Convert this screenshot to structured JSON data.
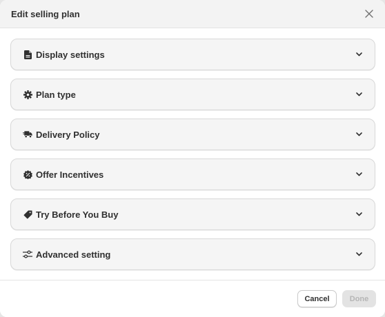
{
  "modal": {
    "title": "Edit selling plan",
    "close_icon": "close-icon"
  },
  "sections": [
    {
      "label": "Display settings",
      "icon": "document-icon"
    },
    {
      "label": "Plan type",
      "icon": "gear-icon"
    },
    {
      "label": "Delivery Policy",
      "icon": "truck-icon"
    },
    {
      "label": "Offer Incentives",
      "icon": "discount-icon"
    },
    {
      "label": "Try Before You Buy",
      "icon": "tag-icon"
    },
    {
      "label": "Advanced setting",
      "icon": "sliders-icon"
    }
  ],
  "footer": {
    "cancel_label": "Cancel",
    "done_label": "Done"
  },
  "colors": {
    "text": "#303030",
    "section_bg": "#f5f5f5",
    "done_disabled_bg": "#e3e3e3"
  }
}
